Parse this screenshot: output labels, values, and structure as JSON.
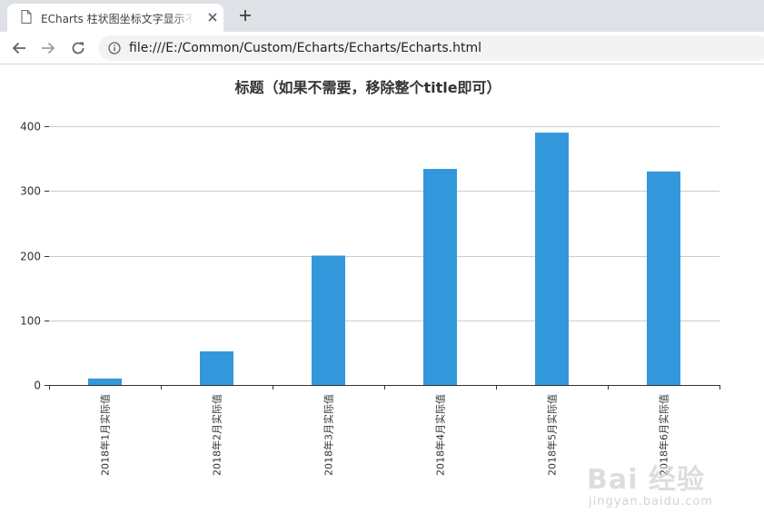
{
  "browser": {
    "tab_title": "ECharts 柱状图坐标文字显示不全",
    "address": "file:///E:/Common/Custom/Echarts/Echarts/Echarts.html",
    "icons": [
      "page-icon",
      "close-icon",
      "plus-icon",
      "back-arrow-icon",
      "forward-arrow-icon",
      "reload-icon",
      "info-icon"
    ]
  },
  "chart_data": {
    "type": "bar",
    "title": "标题（如果不需要，移除整个title即可）",
    "categories": [
      "2018年1月实际值",
      "2018年2月实际值",
      "2018年3月实际值",
      "2018年4月实际值",
      "2018年5月实际值",
      "2018年6月实际值"
    ],
    "values": [
      10,
      52,
      200,
      334,
      390,
      330
    ],
    "ylim": [
      0,
      400
    ],
    "yticks": [
      0,
      100,
      200,
      300,
      400
    ],
    "grid": true,
    "xlabel_rotation": 90,
    "bar_color": "#3398db",
    "grid_color": "#cccccc",
    "axis_color": "#333333"
  },
  "watermark": {
    "brand": "Bai 经验",
    "url": "jingyan.baidu.com"
  }
}
